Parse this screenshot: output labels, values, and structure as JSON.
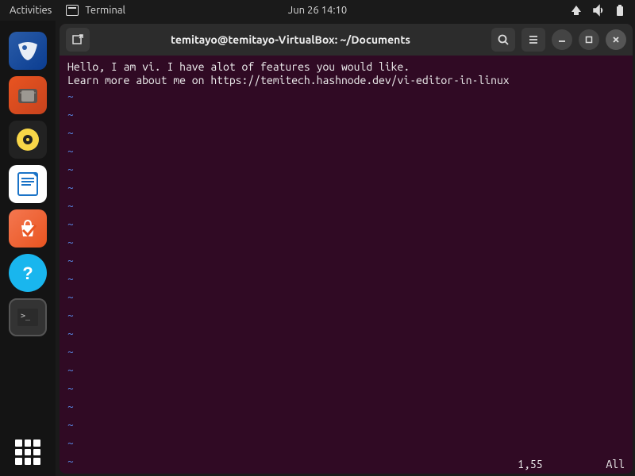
{
  "topbar": {
    "activities": "Activities",
    "app_name": "Terminal",
    "datetime": "Jun 26  14:10"
  },
  "dock": {
    "items": [
      {
        "name": "thunderbird"
      },
      {
        "name": "files"
      },
      {
        "name": "rhythmbox"
      },
      {
        "name": "writer"
      },
      {
        "name": "software"
      },
      {
        "name": "help"
      },
      {
        "name": "terminal"
      }
    ]
  },
  "window": {
    "title": "temitayo@temitayo-VirtualBox: ~/Documents"
  },
  "editor": {
    "lines": [
      "Hello, I am vi. I have alot of features you would like.",
      "Learn more about me on https://temitech.hashnode.dev/vi-editor-in-linux"
    ],
    "tilde_char": "~",
    "status_position": "1,55",
    "status_percent": "All"
  }
}
